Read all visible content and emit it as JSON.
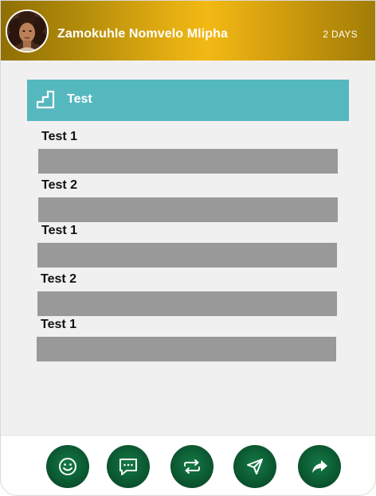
{
  "header": {
    "user_name": "Zamokuhle Nomvelo Mlipha",
    "days_label": "2 DAYS",
    "avatar_icon": "profile-photo"
  },
  "section": {
    "title": "Test",
    "icon": "stairs-icon",
    "accent_color": "#55b8bf"
  },
  "fields": [
    {
      "label": "Test 1",
      "value": ""
    },
    {
      "label": "Test 2",
      "value": ""
    },
    {
      "label": "Test 1",
      "value": ""
    },
    {
      "label": "Test 2",
      "value": ""
    },
    {
      "label": "Test 1",
      "value": ""
    }
  ],
  "actions": [
    {
      "name": "smiley-icon"
    },
    {
      "name": "chat-icon"
    },
    {
      "name": "repeat-icon"
    },
    {
      "name": "send-icon"
    },
    {
      "name": "share-icon"
    }
  ],
  "colors": {
    "header_gold": "#f2b914",
    "button_green": "#0c5a32",
    "field_gray": "#999999"
  }
}
